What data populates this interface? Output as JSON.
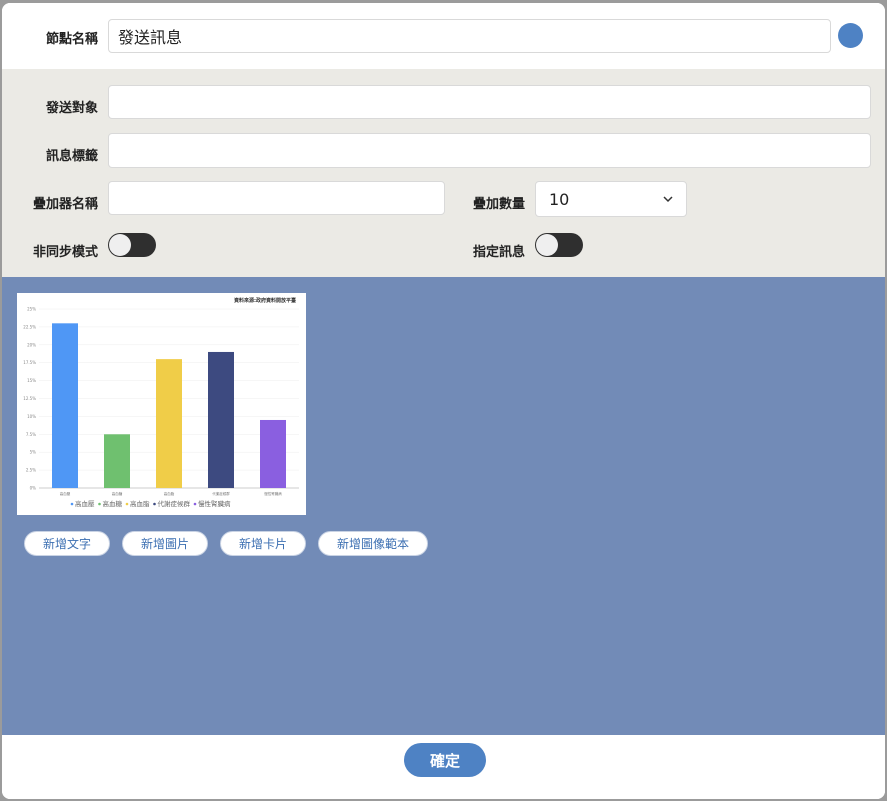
{
  "node": {
    "label": "節點名稱",
    "value": "發送訊息",
    "color": "#4e82c4"
  },
  "settings": {
    "recipient_label": "發送對象",
    "recipient_value": "",
    "tag_label": "訊息標籤",
    "tag_value": "",
    "overlay_name_label": "疊加器名稱",
    "overlay_name_value": "",
    "overlay_count_label": "疊加數量",
    "overlay_count_value": "10",
    "async_label": "非同步模式",
    "async_on": false,
    "specify_label": "指定訊息",
    "specify_on": false
  },
  "chart_data": {
    "type": "bar",
    "title": "資料來源:政府資料開放平臺",
    "categories": [
      "高血壓",
      "高血糖",
      "高血脂",
      "代謝症候群",
      "慢性腎臟病"
    ],
    "values": [
      23,
      7.5,
      18,
      19,
      9.5
    ],
    "colors": [
      "#4f97f5",
      "#6fc06f",
      "#f0cd48",
      "#3d4a80",
      "#8a5fe0"
    ],
    "ylim": [
      0,
      25
    ],
    "yticks": [
      "0%",
      "2.5%",
      "5%",
      "7.5%",
      "10%",
      "12.5%",
      "15%",
      "17.5%",
      "20%",
      "22.5%",
      "25%"
    ],
    "legend": [
      "高血壓",
      "高血糖",
      "高血脂",
      "代謝症候群",
      "慢性腎臟病"
    ],
    "legend_position": "bottom"
  },
  "actions": {
    "add_text": "新增文字",
    "add_image": "新增圖片",
    "add_card": "新增卡片",
    "add_image_template": "新增圖像範本"
  },
  "footer": {
    "confirm": "確定"
  }
}
